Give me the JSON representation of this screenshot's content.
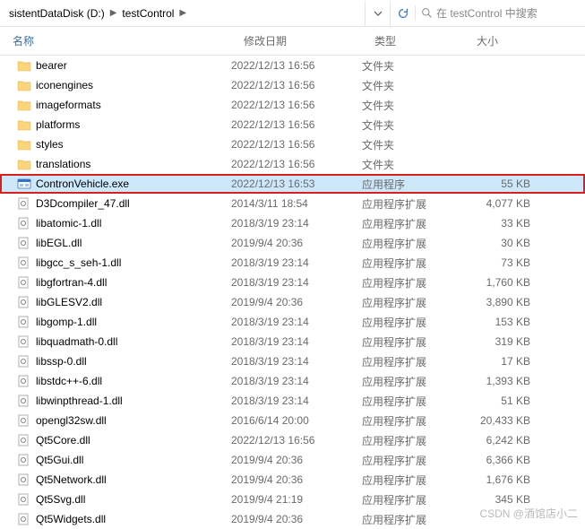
{
  "toolbar": {
    "crumb1": "sistentDataDisk (D:)",
    "crumb2": "testControl",
    "search_placeholder": "在 testControl 中搜索"
  },
  "headers": {
    "name": "名称",
    "date": "修改日期",
    "type": "类型",
    "size": "大小"
  },
  "rows": [
    {
      "icon": "folder",
      "name": "bearer",
      "date": "2022/12/13 16:56",
      "type": "文件夹",
      "size": "",
      "sel": false,
      "hl": false
    },
    {
      "icon": "folder",
      "name": "iconengines",
      "date": "2022/12/13 16:56",
      "type": "文件夹",
      "size": "",
      "sel": false,
      "hl": false
    },
    {
      "icon": "folder",
      "name": "imageformats",
      "date": "2022/12/13 16:56",
      "type": "文件夹",
      "size": "",
      "sel": false,
      "hl": false
    },
    {
      "icon": "folder",
      "name": "platforms",
      "date": "2022/12/13 16:56",
      "type": "文件夹",
      "size": "",
      "sel": false,
      "hl": false
    },
    {
      "icon": "folder",
      "name": "styles",
      "date": "2022/12/13 16:56",
      "type": "文件夹",
      "size": "",
      "sel": false,
      "hl": false
    },
    {
      "icon": "folder",
      "name": "translations",
      "date": "2022/12/13 16:56",
      "type": "文件夹",
      "size": "",
      "sel": false,
      "hl": false
    },
    {
      "icon": "exe",
      "name": "ContronVehicle.exe",
      "date": "2022/12/13 16:53",
      "type": "应用程序",
      "size": "55 KB",
      "sel": true,
      "hl": true
    },
    {
      "icon": "dll",
      "name": "D3Dcompiler_47.dll",
      "date": "2014/3/11 18:54",
      "type": "应用程序扩展",
      "size": "4,077 KB",
      "sel": false,
      "hl": false
    },
    {
      "icon": "dll",
      "name": "libatomic-1.dll",
      "date": "2018/3/19 23:14",
      "type": "应用程序扩展",
      "size": "33 KB",
      "sel": false,
      "hl": false
    },
    {
      "icon": "dll",
      "name": "libEGL.dll",
      "date": "2019/9/4 20:36",
      "type": "应用程序扩展",
      "size": "30 KB",
      "sel": false,
      "hl": false
    },
    {
      "icon": "dll",
      "name": "libgcc_s_seh-1.dll",
      "date": "2018/3/19 23:14",
      "type": "应用程序扩展",
      "size": "73 KB",
      "sel": false,
      "hl": false
    },
    {
      "icon": "dll",
      "name": "libgfortran-4.dll",
      "date": "2018/3/19 23:14",
      "type": "应用程序扩展",
      "size": "1,760 KB",
      "sel": false,
      "hl": false
    },
    {
      "icon": "dll",
      "name": "libGLESV2.dll",
      "date": "2019/9/4 20:36",
      "type": "应用程序扩展",
      "size": "3,890 KB",
      "sel": false,
      "hl": false
    },
    {
      "icon": "dll",
      "name": "libgomp-1.dll",
      "date": "2018/3/19 23:14",
      "type": "应用程序扩展",
      "size": "153 KB",
      "sel": false,
      "hl": false
    },
    {
      "icon": "dll",
      "name": "libquadmath-0.dll",
      "date": "2018/3/19 23:14",
      "type": "应用程序扩展",
      "size": "319 KB",
      "sel": false,
      "hl": false
    },
    {
      "icon": "dll",
      "name": "libssp-0.dll",
      "date": "2018/3/19 23:14",
      "type": "应用程序扩展",
      "size": "17 KB",
      "sel": false,
      "hl": false
    },
    {
      "icon": "dll",
      "name": "libstdc++-6.dll",
      "date": "2018/3/19 23:14",
      "type": "应用程序扩展",
      "size": "1,393 KB",
      "sel": false,
      "hl": false
    },
    {
      "icon": "dll",
      "name": "libwinpthread-1.dll",
      "date": "2018/3/19 23:14",
      "type": "应用程序扩展",
      "size": "51 KB",
      "sel": false,
      "hl": false
    },
    {
      "icon": "dll",
      "name": "opengl32sw.dll",
      "date": "2016/6/14 20:00",
      "type": "应用程序扩展",
      "size": "20,433 KB",
      "sel": false,
      "hl": false
    },
    {
      "icon": "dll",
      "name": "Qt5Core.dll",
      "date": "2022/12/13 16:56",
      "type": "应用程序扩展",
      "size": "6,242 KB",
      "sel": false,
      "hl": false
    },
    {
      "icon": "dll",
      "name": "Qt5Gui.dll",
      "date": "2019/9/4 20:36",
      "type": "应用程序扩展",
      "size": "6,366 KB",
      "sel": false,
      "hl": false
    },
    {
      "icon": "dll",
      "name": "Qt5Network.dll",
      "date": "2019/9/4 20:36",
      "type": "应用程序扩展",
      "size": "1,676 KB",
      "sel": false,
      "hl": false
    },
    {
      "icon": "dll",
      "name": "Qt5Svg.dll",
      "date": "2019/9/4 21:19",
      "type": "应用程序扩展",
      "size": "345 KB",
      "sel": false,
      "hl": false
    },
    {
      "icon": "dll",
      "name": "Qt5Widgets.dll",
      "date": "2019/9/4 20:36",
      "type": "应用程序扩展",
      "size": "",
      "sel": false,
      "hl": false
    }
  ],
  "watermark": "CSDN @酒馆店小二"
}
